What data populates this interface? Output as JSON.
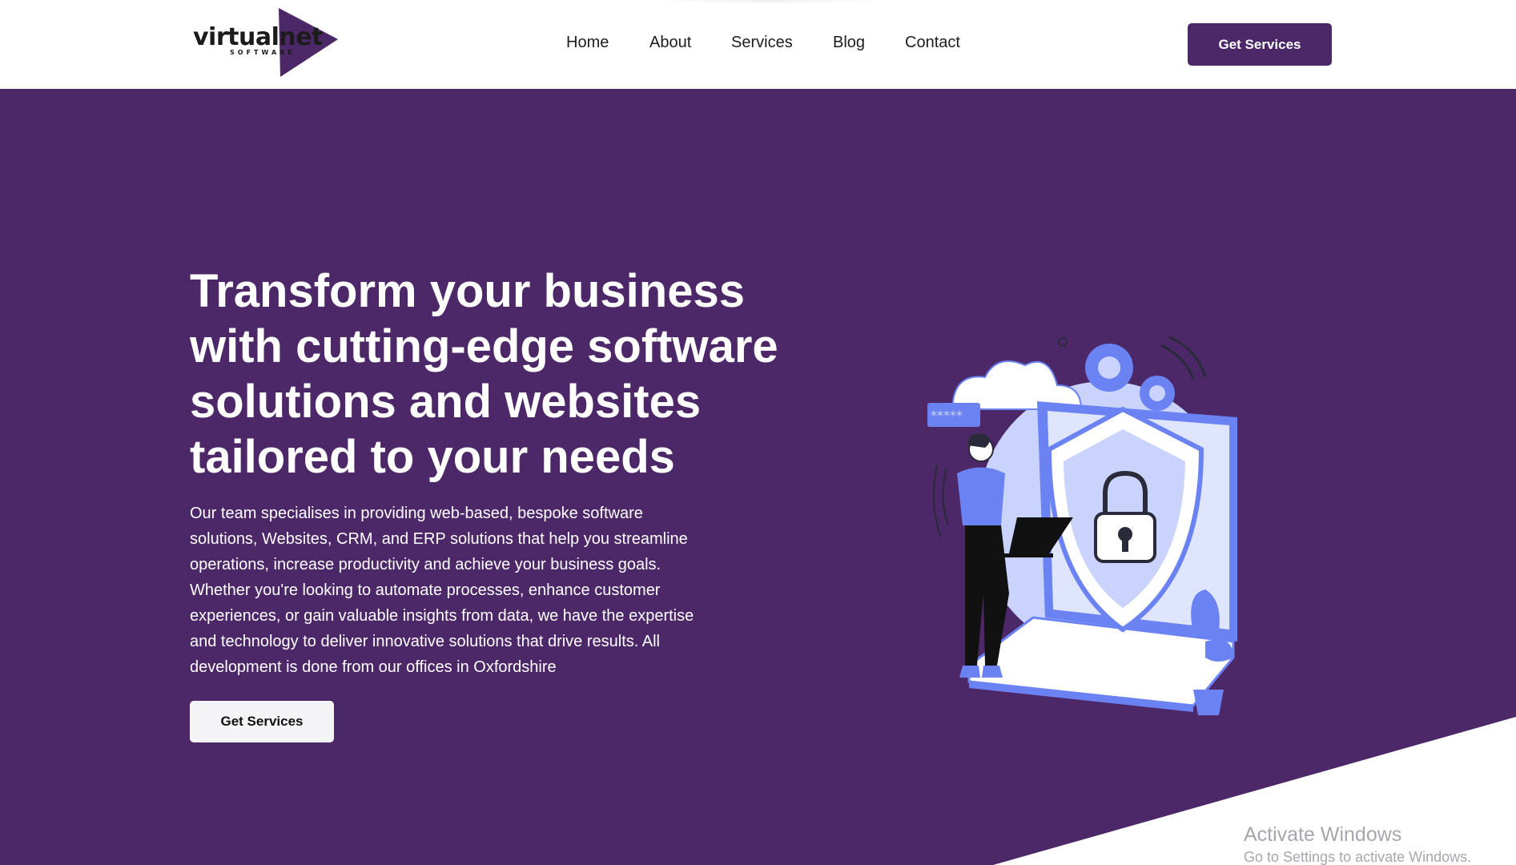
{
  "header": {
    "logo": {
      "wordmark": "virtualnet",
      "tagline": "SOFTWARE"
    },
    "nav": [
      {
        "label": "Home"
      },
      {
        "label": "About"
      },
      {
        "label": "Services"
      },
      {
        "label": "Blog"
      },
      {
        "label": "Contact"
      }
    ],
    "cta_label": "Get Services"
  },
  "hero": {
    "title": "Transform your business with cutting-edge software solutions and websites tailored to your needs",
    "description": "Our team specialises in providing web-based, bespoke software solutions, Websites, CRM, and ERP solutions that help you streamline operations, increase productivity and achieve your business goals. Whether you're looking to automate processes, enhance customer experiences, or gain valuable insights from data, we have the expertise and technology to deliver innovative solutions that drive results. All development is done from our offices in Oxfordshire",
    "cta_label": "Get Services",
    "illustration_rating": "*****"
  },
  "watermark": {
    "title": "Activate Windows",
    "subtitle": "Go to Settings to activate Windows."
  },
  "colors": {
    "brand_purple": "#4d2868",
    "illustration_blue": "#6b82f2",
    "illustration_light": "#c9d3fb",
    "header_bg": "#ffffff"
  }
}
